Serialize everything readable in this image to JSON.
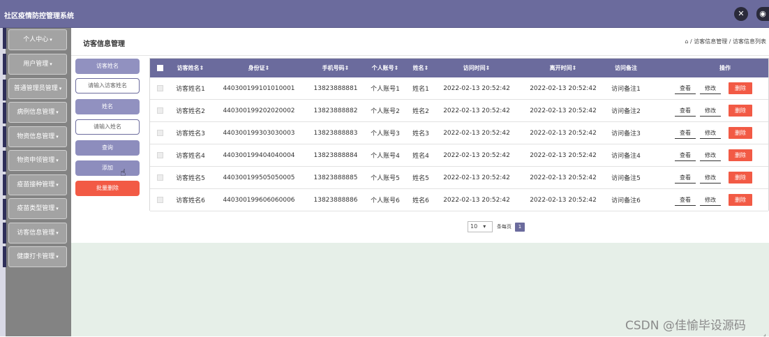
{
  "app": {
    "title": "社区疫情防控管理系统"
  },
  "topbar": {
    "icons": [
      "expand-icon",
      "user-icon"
    ]
  },
  "sidebar": {
    "items": [
      {
        "label": "个人中心"
      },
      {
        "label": "用户管理"
      },
      {
        "label": "普通管理员管理"
      },
      {
        "label": "病例信息管理"
      },
      {
        "label": "物资信息管理"
      },
      {
        "label": "物资申领管理"
      },
      {
        "label": "疫苗接种管理"
      },
      {
        "label": "疫苗类型管理"
      },
      {
        "label": "访客信息管理"
      },
      {
        "label": "健康打卡管理"
      }
    ]
  },
  "header": {
    "page_title": "访客信息管理",
    "breadcrumb": "⌂ / 访客信息管理 / 访客信息列表"
  },
  "search": {
    "visitor_label": "访客姓名",
    "visitor_placeholder": "请输入访客姓名",
    "name_label": "姓名",
    "name_placeholder": "请输入姓名",
    "query_button": "查询",
    "add_button": "添加",
    "batch_delete_button": "批量删除"
  },
  "table": {
    "columns": [
      "访客姓名⇕",
      "身份证⇕",
      "手机号码⇕",
      "个人账号⇕",
      "姓名⇕",
      "访问时间⇕",
      "离开时间⇕",
      "访问备注",
      "操作"
    ],
    "rows": [
      {
        "visitor": "访客姓名1",
        "id_card": "440300199101010001",
        "phone": "13823888881",
        "account": "个人账号1",
        "name": "姓名1",
        "visit_time": "2022-02-13 20:52:42",
        "leave_time": "2022-02-13 20:52:42",
        "remark": "访问备注1"
      },
      {
        "visitor": "访客姓名2",
        "id_card": "440300199202020002",
        "phone": "13823888882",
        "account": "个人账号2",
        "name": "姓名2",
        "visit_time": "2022-02-13 20:52:42",
        "leave_time": "2022-02-13 20:52:42",
        "remark": "访问备注2"
      },
      {
        "visitor": "访客姓名3",
        "id_card": "440300199303030003",
        "phone": "13823888883",
        "account": "个人账号3",
        "name": "姓名3",
        "visit_time": "2022-02-13 20:52:42",
        "leave_time": "2022-02-13 20:52:42",
        "remark": "访问备注3"
      },
      {
        "visitor": "访客姓名4",
        "id_card": "440300199404040004",
        "phone": "13823888884",
        "account": "个人账号4",
        "name": "姓名4",
        "visit_time": "2022-02-13 20:52:42",
        "leave_time": "2022-02-13 20:52:42",
        "remark": "访问备注4"
      },
      {
        "visitor": "访客姓名5",
        "id_card": "440300199505050005",
        "phone": "13823888885",
        "account": "个人账号5",
        "name": "姓名5",
        "visit_time": "2022-02-13 20:52:42",
        "leave_time": "2022-02-13 20:52:42",
        "remark": "访问备注5"
      },
      {
        "visitor": "访客姓名6",
        "id_card": "440300199606060006",
        "phone": "13823888886",
        "account": "个人账号6",
        "name": "姓名6",
        "visit_time": "2022-02-13 20:52:42",
        "leave_time": "2022-02-13 20:52:42",
        "remark": "访问备注6"
      }
    ],
    "actions": {
      "view": "查看",
      "edit": "修改",
      "delete": "删除"
    }
  },
  "pagination": {
    "page_size": "10",
    "per_page_label": "条每页",
    "current_page": "1"
  },
  "watermark": "CSDN @佳愉毕设源码",
  "colors": {
    "primary": "#6b6b9d",
    "danger": "#f25a45",
    "sidebar": "#838383",
    "lower_bg": "#e6efe8"
  }
}
